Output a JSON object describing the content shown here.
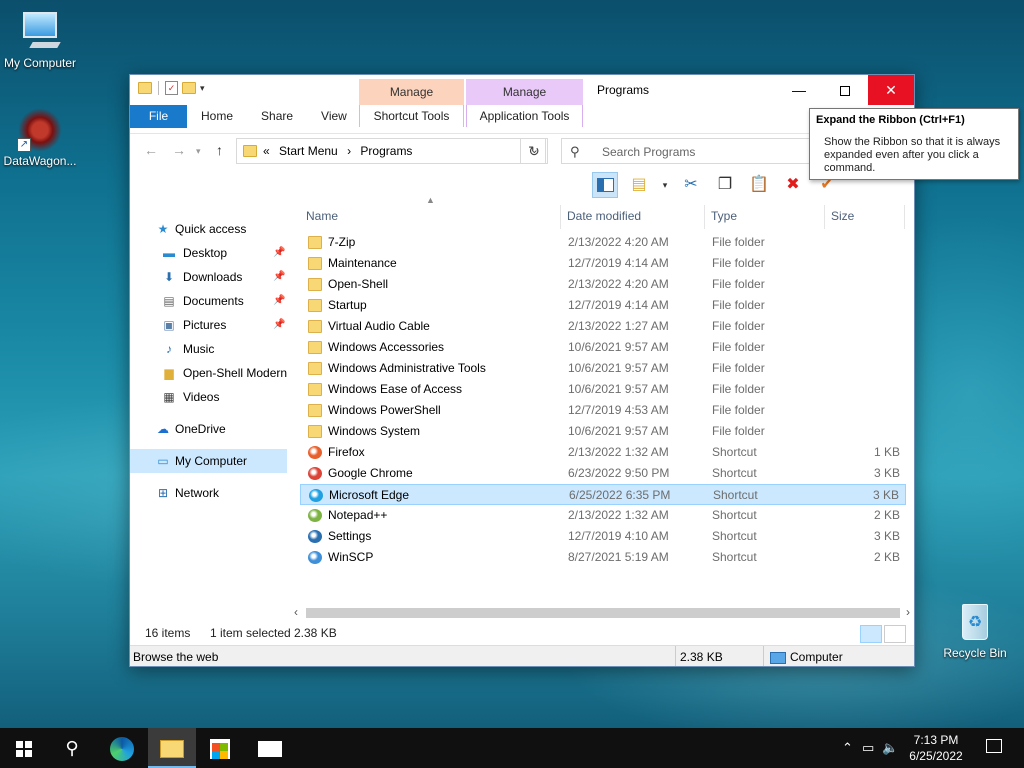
{
  "desktop": {
    "icons": [
      {
        "label": "My Computer"
      },
      {
        "label": "DataWagon..."
      },
      {
        "label": "Recycle Bin"
      }
    ]
  },
  "window": {
    "title": "Programs",
    "context_tabs": [
      {
        "group": "Manage",
        "tab": "Shortcut Tools",
        "color": "#fcd3bd"
      },
      {
        "group": "Manage",
        "tab": "Application Tools",
        "color": "#e8c9f7"
      }
    ],
    "tabs": [
      "File",
      "Home",
      "Share",
      "View"
    ],
    "breadcrumb": {
      "overflow": "«",
      "parts": [
        "Start Menu",
        "›",
        "Programs"
      ]
    },
    "search_placeholder": "Search Programs",
    "accent": "#1979ca",
    "close_color": "#e81123"
  },
  "tooltip": {
    "title": "Expand the Ribbon (Ctrl+F1)",
    "body": "Show the Ribbon so that it is always expanded even after you click a command."
  },
  "nav": [
    {
      "label": "Quick access",
      "level": 0,
      "icon": "star-icon",
      "glyph": "★",
      "color": "#2a8bd1"
    },
    {
      "label": "Desktop",
      "level": 1,
      "icon": "desktop-icon",
      "glyph": "▬",
      "color": "#2a8bd1",
      "pinned": true
    },
    {
      "label": "Downloads",
      "level": 1,
      "icon": "download-icon",
      "glyph": "⬇",
      "color": "#2a6fb0",
      "pinned": true
    },
    {
      "label": "Documents",
      "level": 1,
      "icon": "document-icon",
      "glyph": "▤",
      "color": "#666",
      "pinned": true
    },
    {
      "label": "Pictures",
      "level": 1,
      "icon": "picture-icon",
      "glyph": "▣",
      "color": "#5a7fa8",
      "pinned": true
    },
    {
      "label": "Music",
      "level": 1,
      "icon": "music-icon",
      "glyph": "♪",
      "color": "#2a6fb0"
    },
    {
      "label": "Open-Shell Modern",
      "level": 1,
      "icon": "folder-icon",
      "glyph": "▆",
      "color": "#e0b13a"
    },
    {
      "label": "Videos",
      "level": 1,
      "icon": "video-icon",
      "glyph": "▦",
      "color": "#444"
    },
    {
      "label": "OneDrive",
      "level": 0,
      "icon": "cloud-icon",
      "glyph": "☁",
      "color": "#1d6ed1",
      "gap": true
    },
    {
      "label": "My Computer",
      "level": 0,
      "icon": "computer-icon",
      "glyph": "▭",
      "color": "#2a8bd1",
      "selected": true,
      "gap": true
    },
    {
      "label": "Network",
      "level": 0,
      "icon": "network-icon",
      "glyph": "⊞",
      "color": "#2a6fb0",
      "gap": true
    }
  ],
  "columns": [
    "Name",
    "Date modified",
    "Type",
    "Size"
  ],
  "files": [
    {
      "name": "7-Zip",
      "date": "2/13/2022 4:20 AM",
      "type": "File folder",
      "size": "",
      "kind": "folder"
    },
    {
      "name": "Maintenance",
      "date": "12/7/2019 4:14 AM",
      "type": "File folder",
      "size": "",
      "kind": "folder"
    },
    {
      "name": "Open-Shell",
      "date": "2/13/2022 4:20 AM",
      "type": "File folder",
      "size": "",
      "kind": "folder"
    },
    {
      "name": "Startup",
      "date": "12/7/2019 4:14 AM",
      "type": "File folder",
      "size": "",
      "kind": "folder"
    },
    {
      "name": "Virtual Audio Cable",
      "date": "2/13/2022 1:27 AM",
      "type": "File folder",
      "size": "",
      "kind": "folder"
    },
    {
      "name": "Windows Accessories",
      "date": "10/6/2021 9:57 AM",
      "type": "File folder",
      "size": "",
      "kind": "folder"
    },
    {
      "name": "Windows Administrative Tools",
      "date": "10/6/2021 9:57 AM",
      "type": "File folder",
      "size": "",
      "kind": "folder"
    },
    {
      "name": "Windows Ease of Access",
      "date": "10/6/2021 9:57 AM",
      "type": "File folder",
      "size": "",
      "kind": "folder"
    },
    {
      "name": "Windows PowerShell",
      "date": "12/7/2019 4:53 AM",
      "type": "File folder",
      "size": "",
      "kind": "folder"
    },
    {
      "name": "Windows System",
      "date": "10/6/2021 9:57 AM",
      "type": "File folder",
      "size": "",
      "kind": "folder"
    },
    {
      "name": "Firefox",
      "date": "2/13/2022 1:32 AM",
      "type": "Shortcut",
      "size": "1 KB",
      "kind": "firefox",
      "color": "#e8602c"
    },
    {
      "name": "Google Chrome",
      "date": "6/23/2022 9:50 PM",
      "type": "Shortcut",
      "size": "3 KB",
      "kind": "chrome",
      "color": "#db4437"
    },
    {
      "name": "Microsoft Edge",
      "date": "6/25/2022 6:35 PM",
      "type": "Shortcut",
      "size": "3 KB",
      "kind": "edge",
      "color": "#1fa0e0",
      "selected": true
    },
    {
      "name": "Notepad++",
      "date": "2/13/2022 1:32 AM",
      "type": "Shortcut",
      "size": "2 KB",
      "kind": "notepad",
      "color": "#7cb342"
    },
    {
      "name": "Settings",
      "date": "12/7/2019 4:10 AM",
      "type": "Shortcut",
      "size": "3 KB",
      "kind": "settings",
      "color": "#2a6fb0"
    },
    {
      "name": "WinSCP",
      "date": "8/27/2021 5:19 AM",
      "type": "Shortcut",
      "size": "2 KB",
      "kind": "winscp",
      "color": "#3f8fd8"
    }
  ],
  "status": {
    "count": "16 items",
    "selected": "1 item selected",
    "size": "2.38 KB",
    "info": "Browse the web",
    "info_size": "2.38 KB",
    "location": "Computer"
  },
  "taskbar": {
    "time": "7:13 PM",
    "date": "6/25/2022"
  }
}
